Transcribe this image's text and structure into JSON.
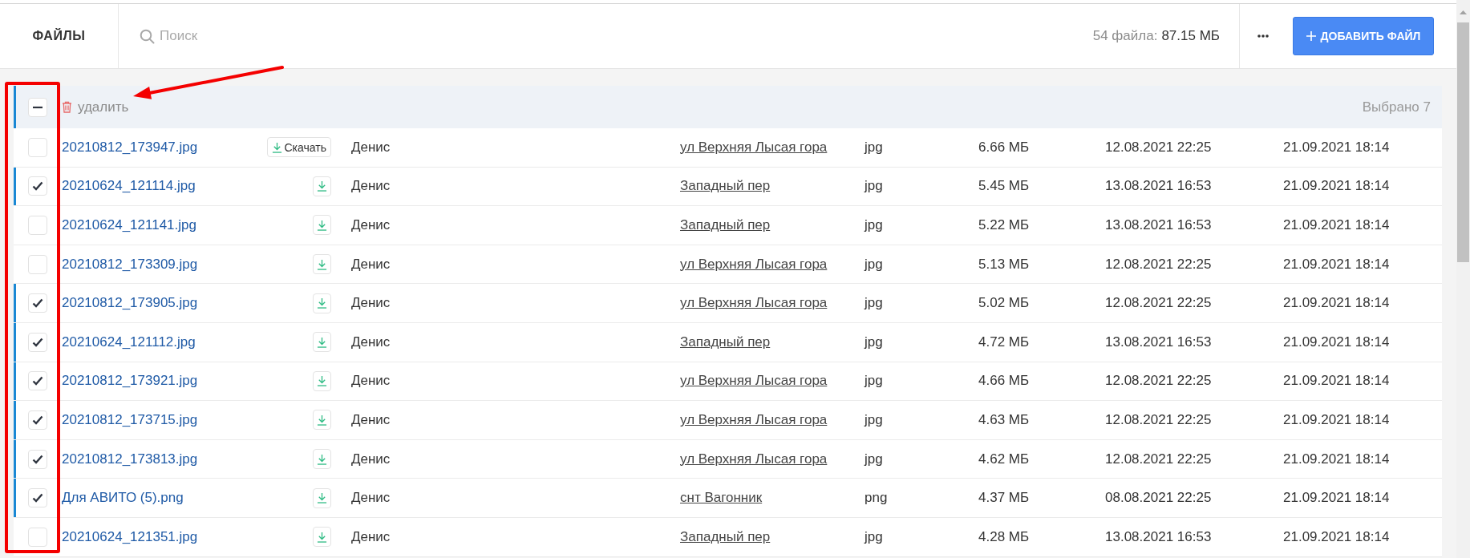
{
  "header": {
    "title": "ФАЙЛЫ",
    "search": {
      "placeholder": "Поиск"
    },
    "summary": {
      "count": "54 файла:",
      "size": "87.15 МБ"
    },
    "add_button": "ДОБАВИТЬ ФАЙЛ"
  },
  "selection_bar": {
    "select_all": {
      "partial": true
    },
    "delete_action": "удалить",
    "selected_count": "Выбрано 7"
  },
  "rows": [
    {
      "selected": false,
      "column_1": "20210812_173947.jpg",
      "download_label": "Скачать",
      "column_2": "Денис",
      "column_3": "ул Верхняя Лысая гора",
      "column_4": "jpg",
      "column_5": "6.66 МБ",
      "column_6": "12.08.2021 22:25",
      "column_7": "21.09.2021 18:14"
    },
    {
      "selected": true,
      "column_1": "20210624_121114.jpg",
      "column_2": "Денис",
      "column_3": "Западный пер",
      "column_4": "jpg",
      "column_5": "5.45 МБ",
      "column_6": "13.08.2021 16:53",
      "column_7": "21.09.2021 18:14"
    },
    {
      "selected": false,
      "column_1": "20210624_121141.jpg",
      "column_2": "Денис",
      "column_3": "Западный пер",
      "column_4": "jpg",
      "column_5": "5.22 МБ",
      "column_6": "13.08.2021 16:53",
      "column_7": "21.09.2021 18:14"
    },
    {
      "selected": false,
      "column_1": "20210812_173309.jpg",
      "column_2": "Денис",
      "column_3": "ул Верхняя Лысая гора",
      "column_4": "jpg",
      "column_5": "5.13 МБ",
      "column_6": "12.08.2021 22:25",
      "column_7": "21.09.2021 18:14"
    },
    {
      "selected": true,
      "column_1": "20210812_173905.jpg",
      "column_2": "Денис",
      "column_3": "ул Верхняя Лысая гора",
      "column_4": "jpg",
      "column_5": "5.02 МБ",
      "column_6": "12.08.2021 22:25",
      "column_7": "21.09.2021 18:14"
    },
    {
      "selected": true,
      "column_1": "20210624_121112.jpg",
      "column_2": "Денис",
      "column_3": "Западный пер",
      "column_4": "jpg",
      "column_5": "4.72 МБ",
      "column_6": "13.08.2021 16:53",
      "column_7": "21.09.2021 18:14"
    },
    {
      "selected": true,
      "column_1": "20210812_173921.jpg",
      "column_2": "Денис",
      "column_3": "ул Верхняя Лысая гора",
      "column_4": "jpg",
      "column_5": "4.66 МБ",
      "column_6": "12.08.2021 22:25",
      "column_7": "21.09.2021 18:14"
    },
    {
      "selected": true,
      "column_1": "20210812_173715.jpg",
      "column_2": "Денис",
      "column_3": "ул Верхняя Лысая гора",
      "column_4": "jpg",
      "column_5": "4.63 МБ",
      "column_6": "12.08.2021 22:25",
      "column_7": "21.09.2021 18:14"
    },
    {
      "selected": true,
      "column_1": "20210812_173813.jpg",
      "column_2": "Денис",
      "column_3": "ул Верхняя Лысая гора",
      "column_4": "jpg",
      "column_5": "4.62 МБ",
      "column_6": "12.08.2021 22:25",
      "column_7": "21.09.2021 18:14"
    },
    {
      "selected": true,
      "column_1": "Для АВИТО (5).png",
      "column_2": "Денис",
      "column_3": "снт Вагонник",
      "column_4": "png",
      "column_5": "4.37 МБ",
      "column_6": "08.08.2021 22:25",
      "column_7": "21.09.2021 18:14"
    },
    {
      "selected": false,
      "column_1": "20210624_121351.jpg",
      "column_2": "Денис",
      "column_3": "Западный пер",
      "column_4": "jpg",
      "column_5": "4.28 МБ",
      "column_6": "13.08.2021 16:53",
      "column_7": "21.09.2021 18:14"
    }
  ],
  "annotations": {
    "frame": true,
    "arrow": true
  }
}
